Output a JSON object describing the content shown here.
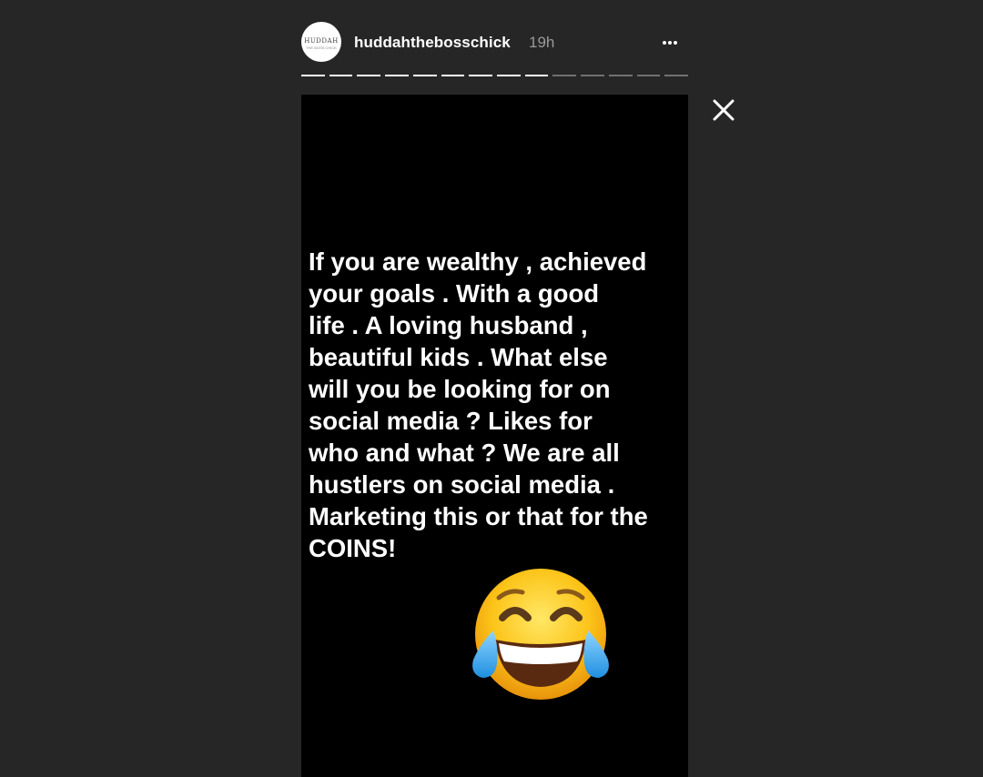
{
  "header": {
    "avatar_text": "HUDDAH",
    "avatar_subtext": "THE BOSS CHICK",
    "username": "huddahthebosschick",
    "timestamp": "19h",
    "more_icon": "more-horizontal-icon"
  },
  "progress": {
    "segments_total": 14,
    "segments_done": 9
  },
  "story": {
    "text": "If you are wealthy , achieved\nyour goals . With a good\nlife . A loving husband ,\nbeautiful kids . What else\nwill you be looking for on\nsocial media ? Likes for\nwho and what ? We are all\nhustlers on social media .\nMarketing this or that for the\nCOINS!",
    "emoji": "face-with-tears-of-joy-icon",
    "background_color": "#000000",
    "text_color": "#ffffff"
  },
  "controls": {
    "close_icon": "close-icon"
  },
  "colors": {
    "page_background": "#262626",
    "timestamp": "#9a9a9a"
  }
}
